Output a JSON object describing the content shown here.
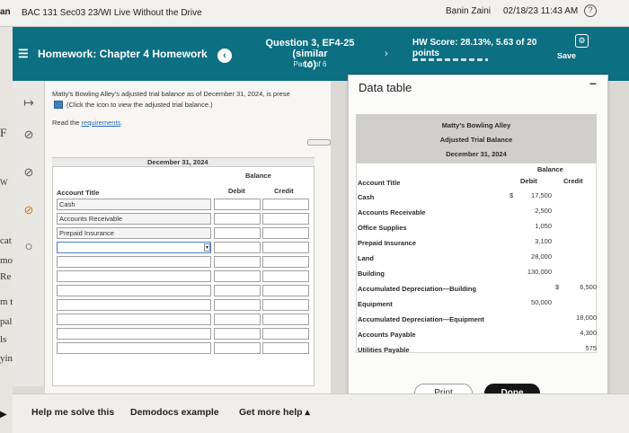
{
  "topbar": {
    "course": "BAC 131 Sec03 23/WI Live Without the Drive",
    "user": "Banin Zaini",
    "datetime": "02/18/23 11:43 AM",
    "left_fragment": "an"
  },
  "header": {
    "homework": "Homework: Chapter 4 Homework",
    "question_line1": "Question 3, EF4-25 (similar",
    "question_line2": "to)",
    "part": "Part 5 of 6",
    "score_line1": "HW Score: 28.13%, 5.63 of 20",
    "score_line2": "points",
    "save_label": "Save"
  },
  "left_margin_fragments": [
    "F",
    "W",
    "cat",
    "mo",
    "Re",
    "m t",
    "pal",
    "ls",
    "yin"
  ],
  "main": {
    "intro": "Matty's Bowling Alley's adjusted trial balance as of December 31, 2024, is prese",
    "click_icon_text": "(Click the icon to view the adjusted trial balance.)",
    "read_prefix": "Read the ",
    "requirements_link": "requirements",
    "read_suffix": "."
  },
  "worksheet": {
    "date_header": "December 31, 2024",
    "balance_header": "Balance",
    "col_account": "Account Title",
    "col_debit": "Debit",
    "col_credit": "Credit",
    "rows": [
      "Cash",
      "Accounts Receivable",
      "Prepaid Insurance",
      "",
      "",
      "",
      "",
      "",
      "",
      "",
      ""
    ]
  },
  "data_table": {
    "title": "Data table",
    "company": "Matty's Bowling Alley",
    "statement": "Adjusted Trial Balance",
    "date": "December 31, 2024",
    "balance": "Balance",
    "col_account": "Account Title",
    "col_debit": "Debit",
    "col_credit": "Credit",
    "rows": [
      {
        "account": "Cash",
        "debit_sign": "$",
        "debit": "17,500",
        "credit_sign": "",
        "credit": ""
      },
      {
        "account": "Accounts Receivable",
        "debit_sign": "",
        "debit": "2,500",
        "credit_sign": "",
        "credit": ""
      },
      {
        "account": "Office Supplies",
        "debit_sign": "",
        "debit": "1,050",
        "credit_sign": "",
        "credit": ""
      },
      {
        "account": "Prepaid Insurance",
        "debit_sign": "",
        "debit": "3,100",
        "credit_sign": "",
        "credit": ""
      },
      {
        "account": "Land",
        "debit_sign": "",
        "debit": "28,000",
        "credit_sign": "",
        "credit": ""
      },
      {
        "account": "Building",
        "debit_sign": "",
        "debit": "130,000",
        "credit_sign": "",
        "credit": ""
      },
      {
        "account": "Accumulated Depreciation—Building",
        "debit_sign": "",
        "debit": "",
        "credit_sign": "$",
        "credit": "6,500"
      },
      {
        "account": "Equipment",
        "debit_sign": "",
        "debit": "50,000",
        "credit_sign": "",
        "credit": ""
      },
      {
        "account": "Accumulated Depreciation—Equipment",
        "debit_sign": "",
        "debit": "",
        "credit_sign": "",
        "credit": "18,000"
      },
      {
        "account": "Accounts Payable",
        "debit_sign": "",
        "debit": "",
        "credit_sign": "",
        "credit": "4,300"
      },
      {
        "account": "Utilities Payable",
        "debit_sign": "",
        "debit": "",
        "credit_sign": "",
        "credit": "575"
      }
    ],
    "print_label": "Print",
    "done_label": "Done"
  },
  "bottom": {
    "help": "Help me solve this",
    "demodocs": "Demodocs example",
    "more_help": "Get more help ▴"
  },
  "colors": {
    "header_teal": "#0c6f82",
    "done_black": "#151515",
    "link_blue": "#2a6ab8"
  }
}
